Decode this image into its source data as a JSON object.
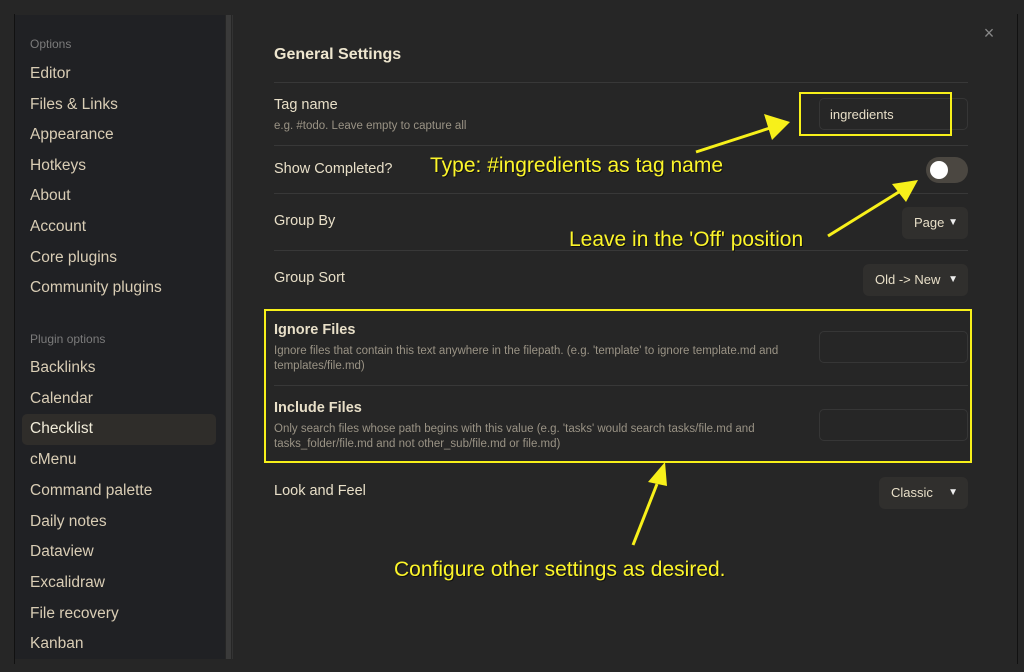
{
  "sidebar": {
    "options_heading": "Options",
    "options": [
      {
        "label": "Editor"
      },
      {
        "label": "Files & Links"
      },
      {
        "label": "Appearance"
      },
      {
        "label": "Hotkeys"
      },
      {
        "label": "About"
      },
      {
        "label": "Account"
      },
      {
        "label": "Core plugins"
      },
      {
        "label": "Community plugins"
      }
    ],
    "plugin_heading": "Plugin options",
    "plugins": [
      {
        "label": "Backlinks"
      },
      {
        "label": "Calendar"
      },
      {
        "label": "Checklist",
        "active": true
      },
      {
        "label": "cMenu"
      },
      {
        "label": "Command palette"
      },
      {
        "label": "Daily notes"
      },
      {
        "label": "Dataview"
      },
      {
        "label": "Excalidraw"
      },
      {
        "label": "File recovery"
      },
      {
        "label": "Kanban"
      }
    ]
  },
  "close_icon": "×",
  "main": {
    "title": "General Settings",
    "tag_name": {
      "label": "Tag name",
      "description": "e.g. #todo. Leave empty to capture all",
      "value": "ingredients"
    },
    "show_completed": {
      "label": "Show Completed?",
      "enabled": false
    },
    "group_by": {
      "label": "Group By",
      "selected": "Page"
    },
    "group_sort": {
      "label": "Group Sort",
      "selected": "Old -> New"
    },
    "ignore_files": {
      "label": "Ignore Files",
      "description": "Ignore files that contain this text anywhere in the filepath. (e.g. 'template' to ignore template.md and templates/file.md)",
      "value": ""
    },
    "include_files": {
      "label": "Include Files",
      "description": "Only search files whose path begins with this value (e.g. 'tasks' would search tasks/file.md and tasks_folder/file.md and not other_sub/file.md or file.md)",
      "value": ""
    },
    "look_and_feel": {
      "label": "Look and Feel",
      "selected": "Classic"
    }
  },
  "annotations": {
    "tag_hint": "Type: #ingredients as tag name",
    "toggle_hint": "Leave in the 'Off' position",
    "other_hint": "Configure other settings as desired.",
    "color": "#f7f01a"
  },
  "colors": {
    "background": "#262626",
    "sidebar": "#202124",
    "text": "#e8dfc8",
    "toggle_off": "#4b4741"
  }
}
